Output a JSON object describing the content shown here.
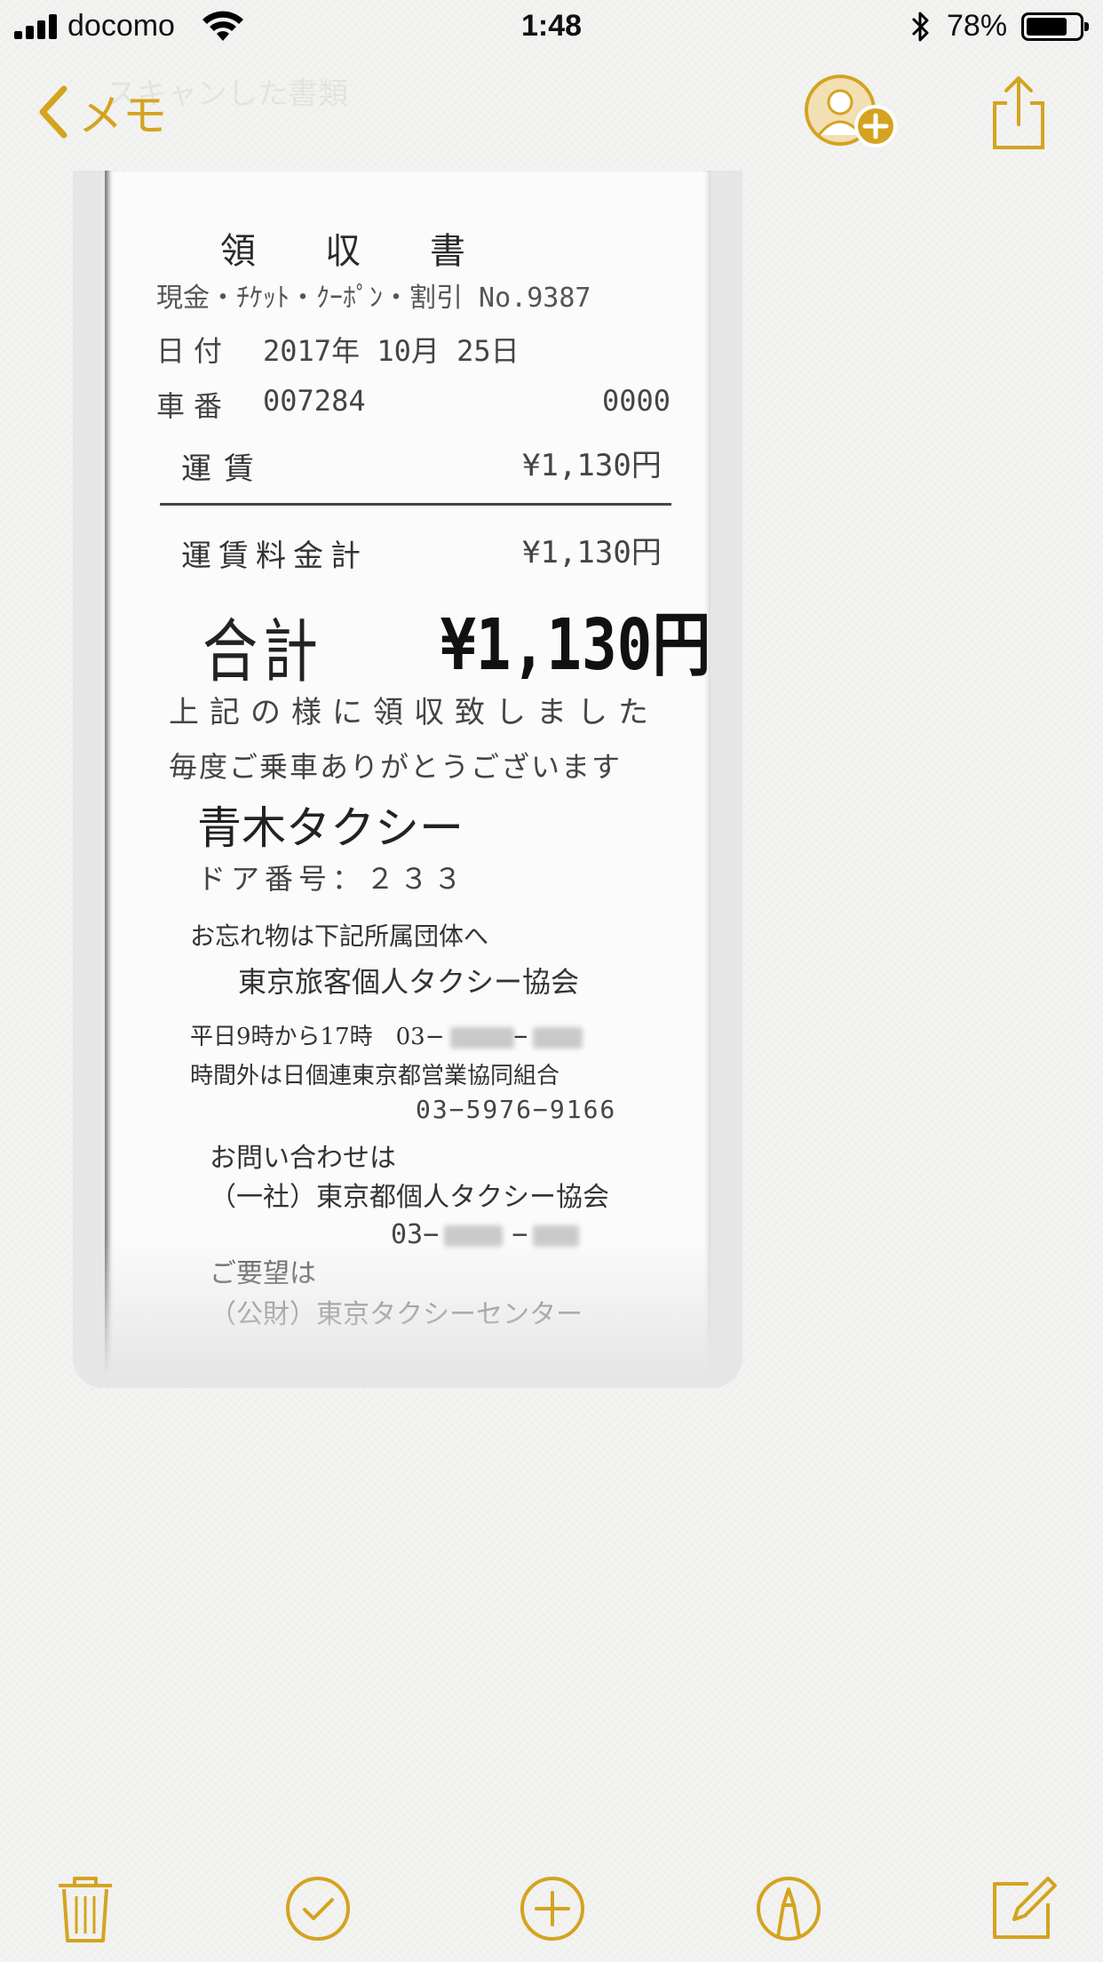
{
  "status_bar": {
    "carrier": "docomo",
    "time": "1:48",
    "battery_percent_label": "78%",
    "battery_level": 0.78
  },
  "nav": {
    "back_label": "メモ",
    "ghost_title": "スキャンした書類"
  },
  "receipt": {
    "title": "領収書",
    "payment_line": "現金・ﾁｹｯﾄ・ｸｰﾎﾟﾝ・割引 No.9387",
    "date_label": "日付",
    "date_value": "2017年 10月 25日",
    "car_label": "車番",
    "car_number": "007284",
    "code": "0000",
    "fare_label": "運賃",
    "fare_value": "¥1,130円",
    "fare_total_label": "運賃料金計",
    "fare_total_value": "¥1,130円",
    "total_label": "合計",
    "total_value": "¥1,130円",
    "thanks_line1": "上記の様に領収致しました",
    "thanks_line2": "毎度ご乗車ありがとうございます",
    "company": "青木タクシー",
    "door_number": "ドア番号：２３３",
    "lost_line1": "お忘れ物は下記所属団体へ",
    "lost_line2": "東京旅客個人タクシー協会",
    "weekday_hours": "平日9時から17時　03−",
    "after_hours_line1": "時間外は日個連東京都営業協同組合",
    "after_hours_phone": "03−5976−9166",
    "contact_line1": "お問い合わせは",
    "contact_line2": "（一社）東京都個人タクシー協会",
    "contact_phone": "03−",
    "request_line1": "ご要望は",
    "request_line2": "（公財）東京タクシーセンター"
  },
  "colors": {
    "accent": "#d4a31f",
    "background": "#f3f3f1"
  },
  "toolbar": {
    "icons": [
      "trash-icon",
      "checklist-icon",
      "add-icon",
      "markup-icon",
      "compose-icon"
    ]
  }
}
